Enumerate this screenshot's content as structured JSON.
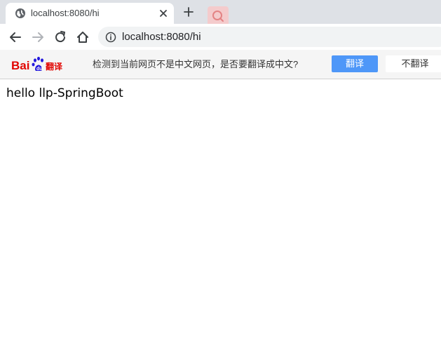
{
  "tab": {
    "title": "localhost:8080/hi",
    "favicon": "globe-icon",
    "close_icon": "close-icon"
  },
  "tabstrip": {
    "new_tab_icon": "plus-icon",
    "extension_icon": "search-icon"
  },
  "toolbar": {
    "back_icon": "arrow-left-icon",
    "forward_icon": "arrow-right-icon",
    "reload_icon": "reload-icon",
    "home_icon": "home-icon",
    "site_info_icon": "info-icon",
    "url": "localhost:8080/hi"
  },
  "translate_bar": {
    "logo_text": "Bai翻译",
    "message": "检测到当前网页不是中文网页，是否要翻译成中文?",
    "translate_label": "翻译",
    "no_translate_label": "不翻译",
    "colors": {
      "translate_button": "#4e97f8",
      "logo_red": "#e10602",
      "logo_blue": "#2319dc"
    }
  },
  "page": {
    "text": "hello llp-SpringBoot"
  }
}
